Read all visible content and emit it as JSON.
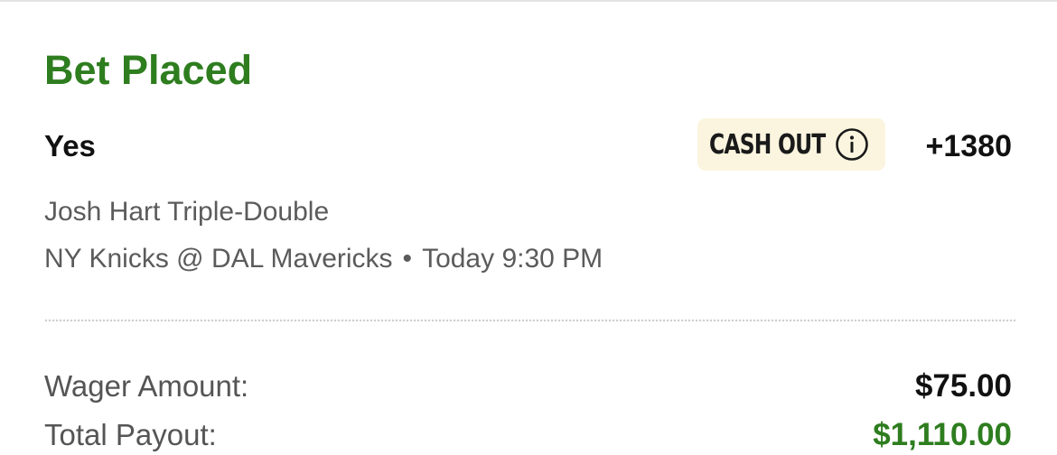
{
  "colors": {
    "accent_green": "#2e7d1f",
    "cashout_background": "#fbf5df",
    "text_primary": "#111111",
    "text_secondary": "#5b5b5b"
  },
  "header": {
    "title": "Bet Placed"
  },
  "bet": {
    "selection": "Yes",
    "cash_out_label": "CASH OUT",
    "cash_out_icon": "info-circle-icon",
    "odds": "+1380",
    "market": "Josh Hart Triple-Double",
    "event": "NY Knicks @ DAL Mavericks",
    "separator": "•",
    "time": "Today 9:30 PM"
  },
  "summary": {
    "wager_label": "Wager Amount:",
    "wager_value": "$75.00",
    "payout_label": "Total Payout:",
    "payout_value": "$1,110.00"
  }
}
